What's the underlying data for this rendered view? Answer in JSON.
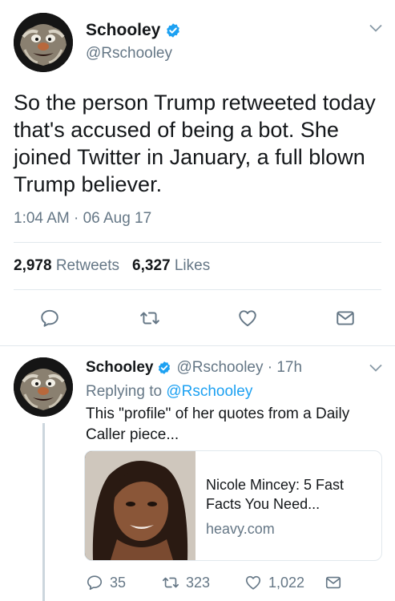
{
  "main_tweet": {
    "name": "Schooley",
    "handle": "@Rschooley",
    "text": "So the person Trump retweeted today that's accused of being a bot. She joined Twitter in January, a full blown Trump believer.",
    "timestamp": "1:04 AM · 06 Aug 17",
    "retweets_count": "2,978",
    "retweets_label": "Retweets",
    "likes_count": "6,327",
    "likes_label": "Likes"
  },
  "reply_tweet": {
    "name": "Schooley",
    "meta": "@Rschooley · 17h",
    "replying_prefix": "Replying to",
    "replying_to": "@Rschooley",
    "text": "This \"profile\" of her quotes from a Daily Caller piece...",
    "card": {
      "title": "Nicole Mincey: 5 Fast Facts You Need...",
      "domain": "heavy.com"
    },
    "reply_count": "35",
    "retweet_count": "323",
    "like_count": "1,022"
  },
  "colors": {
    "accent": "#1da1f2",
    "muted": "#657786",
    "text": "#14171a",
    "divider": "#e1e8ed"
  }
}
